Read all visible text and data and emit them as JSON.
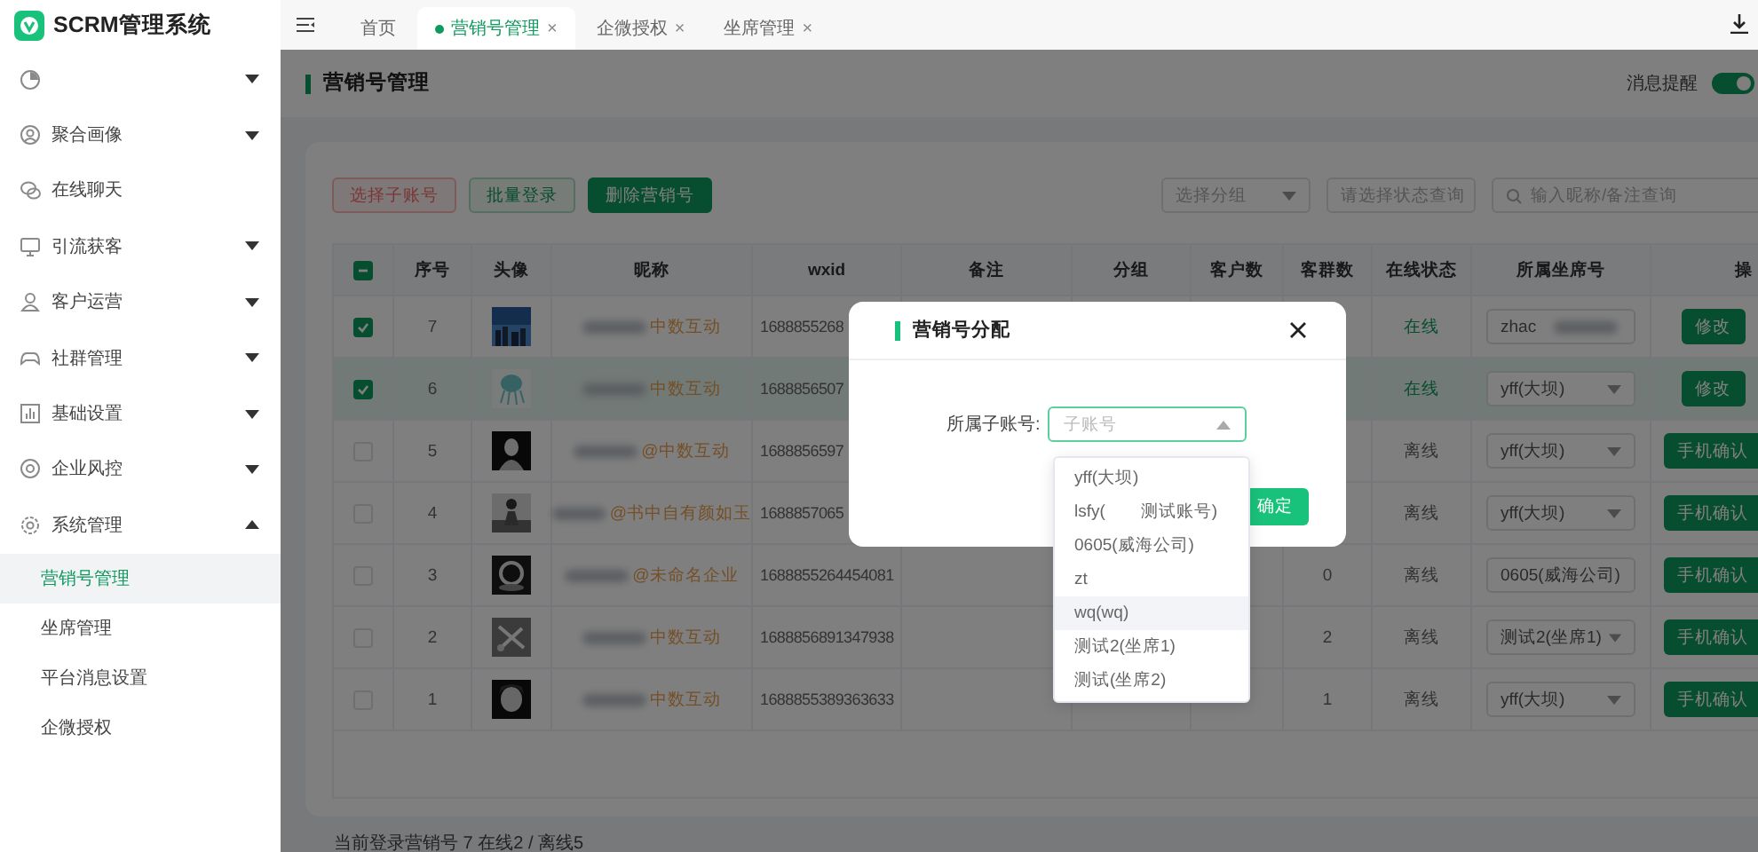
{
  "sidebar": {
    "logo_text": "SCRM管理系统",
    "items": [
      {
        "expanded": false
      },
      {
        "label": "聚合画像",
        "expanded": false
      },
      {
        "label": "在线聊天"
      },
      {
        "label": "引流获客",
        "expanded": false
      },
      {
        "label": "客户运营",
        "expanded": false
      },
      {
        "label": "社群管理",
        "expanded": false
      },
      {
        "label": "基础设置",
        "expanded": false
      },
      {
        "label": "企业风控",
        "expanded": false
      },
      {
        "label": "系统管理",
        "expanded": true,
        "children": [
          {
            "label": "营销号管理",
            "selected": true
          },
          {
            "label": "坐席管理",
            "selected": false
          },
          {
            "label": "平台消息设置",
            "selected": false
          },
          {
            "label": "企微授权",
            "selected": false
          }
        ]
      }
    ]
  },
  "tabs": [
    {
      "label": "首页",
      "selected": false
    },
    {
      "label": "营销号管理",
      "selected": true,
      "close": "×"
    },
    {
      "label": "企微授权",
      "selected": false,
      "close": "×"
    },
    {
      "label": "坐席管理",
      "selected": false,
      "close": "×"
    }
  ],
  "page": {
    "title": "营销号管理",
    "notify_label": "消息提醒",
    "notify_on": true
  },
  "toolbar": {
    "buttons": [
      {
        "label": "选择子账号",
        "kind": "danger"
      },
      {
        "label": "批量登录",
        "kind": "outline"
      },
      {
        "label": "删除营销号",
        "kind": "primary"
      }
    ],
    "filters": [
      {
        "placeholder": "选择分组",
        "kind": "select"
      },
      {
        "placeholder": "请选择状态查询",
        "kind": "select"
      },
      {
        "placeholder": "输入昵称/备注查询",
        "kind": "search"
      }
    ]
  },
  "table": {
    "select_all_indeterminate": true,
    "columns": [
      "序号",
      "头像",
      "昵称",
      "wxid",
      "备注",
      "分组",
      "客户数",
      "客群数",
      "在线状态",
      "所属坐席号",
      "操"
    ],
    "rows": [
      {
        "checked": true,
        "highlighted": false,
        "index": "7",
        "nickname": "中数互动",
        "wxid": "1688855268",
        "online": true,
        "status": "在线",
        "seat": {
          "kind": "input",
          "value": "zhac"
        },
        "action": "修改"
      },
      {
        "checked": true,
        "highlighted": true,
        "index": "6",
        "nickname": "中数互动",
        "wxid": "1688856507",
        "online": true,
        "status": "在线",
        "seat": {
          "kind": "select",
          "value": "yff(大坝)"
        },
        "action": "修改"
      },
      {
        "checked": false,
        "highlighted": false,
        "index": "5",
        "nickname": "@中数互动",
        "wxid": "1688856597",
        "online": false,
        "status": "离线",
        "seat": {
          "kind": "select",
          "value": "yff(大坝)"
        },
        "action": "手机确认"
      },
      {
        "checked": false,
        "highlighted": false,
        "index": "4",
        "nickname": "@书中自有颜如玉",
        "wxid": "1688857065",
        "online": false,
        "status": "离线",
        "seat": {
          "kind": "select",
          "value": "yff(大坝)"
        },
        "action": "手机确认"
      },
      {
        "checked": false,
        "highlighted": false,
        "index": "3",
        "nickname": "@未命名企业",
        "wxid": "1688855264454081",
        "group_count": "0",
        "online": false,
        "status": "离线",
        "seat": {
          "kind": "select",
          "value": "0605(威海公司)"
        },
        "action": "手机确认"
      },
      {
        "checked": false,
        "highlighted": false,
        "index": "2",
        "nickname": "中数互动",
        "wxid": "1688856891347938",
        "group_count": "2",
        "online": false,
        "status": "离线",
        "seat": {
          "kind": "select",
          "value": "测试2(坐席1)"
        },
        "action": "手机确认"
      },
      {
        "checked": false,
        "highlighted": false,
        "index": "1",
        "nickname": "中数互动",
        "wxid": "1688855389363633",
        "group_count": "1",
        "online": false,
        "status": "离线",
        "seat": {
          "kind": "select",
          "value": "yff(大坝)"
        },
        "action": "手机确认"
      }
    ]
  },
  "footer": "当前登录营销号 7 在线2 / 离线5",
  "modal": {
    "title": "营销号分配",
    "field_label": "所属子账号:",
    "placeholder": "子账号",
    "expanded": true,
    "confirm": "确定",
    "options": [
      {
        "label": "yff(大坝)",
        "hovered": false
      },
      {
        "label": "lsfy(　　测试账号)",
        "hovered": false
      },
      {
        "label": "0605(威海公司)",
        "hovered": false
      },
      {
        "label": "zt",
        "hovered": false
      },
      {
        "label": "wq(wq)",
        "hovered": true
      },
      {
        "label": "测试2(坐席1)",
        "hovered": false
      },
      {
        "label": "测试(坐席2)",
        "hovered": false
      }
    ]
  }
}
